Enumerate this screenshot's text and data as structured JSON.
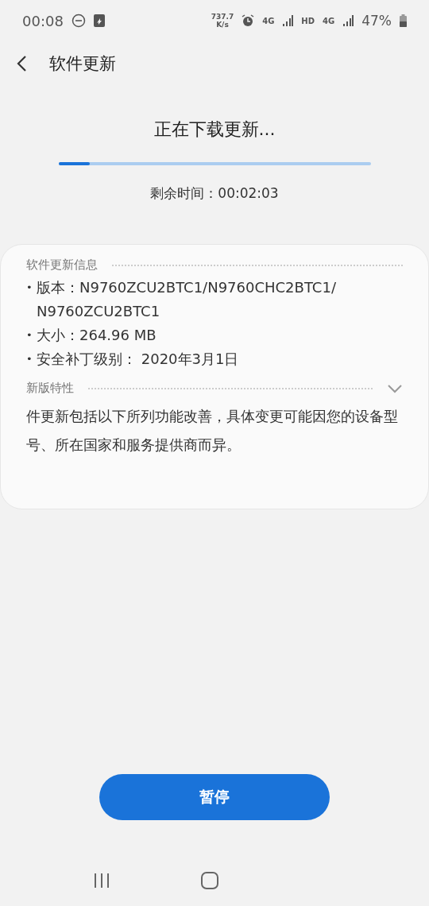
{
  "status_bar": {
    "time": "00:08",
    "net_speed": [
      "737.7",
      "K/s"
    ],
    "sim1": "4G",
    "hd": "HD",
    "sim2": "4G",
    "battery": "47%"
  },
  "header": {
    "title": "软件更新"
  },
  "download": {
    "status": "正在下载更新...",
    "level": 0.1,
    "remaining": "剩余时间：00:02:03"
  },
  "info_card": {
    "heading": "软件更新信息",
    "items": [
      {
        "bullet": "•",
        "lines": [
          "版本：N9760ZCU2BTC1/N9760CHC2BTC1/",
          "N9760ZCU2BTC1"
        ]
      },
      {
        "bullet": "•",
        "lines": [
          "大小：264.96 MB"
        ]
      },
      {
        "bullet": "•",
        "lines": [
          "安全补丁级别： 2020年3月1日"
        ]
      }
    ],
    "features": {
      "heading": "新版特性",
      "expanded": false,
      "text": "件更新包括以下所列功能改善，具体变更可能因您的设备型号、所在国家和服务提供商而异。"
    }
  },
  "pause_button": {
    "label": "暂停"
  }
}
